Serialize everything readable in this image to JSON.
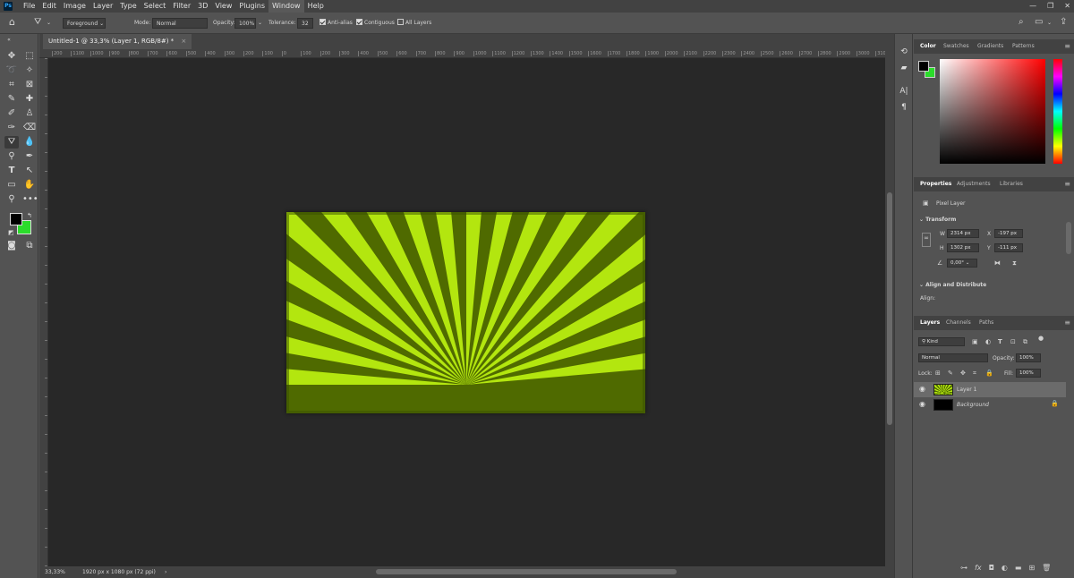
{
  "app": {
    "logo": "Ps"
  },
  "menu": [
    "File",
    "Edit",
    "Image",
    "Layer",
    "Type",
    "Select",
    "Filter",
    "3D",
    "View",
    "Plugins",
    "Window",
    "Help"
  ],
  "menu_active": "Window",
  "window_controls": [
    "—",
    "❐",
    "✕"
  ],
  "options": {
    "preset": "Foreground",
    "mode_label": "Mode:",
    "mode_value": "Normal",
    "opacity_label": "Opacity:",
    "opacity_value": "100%",
    "tolerance_label": "Tolerance:",
    "tolerance_value": "32",
    "anti_alias": "Anti-alias",
    "contiguous": "Contiguous",
    "all_layers": "All Layers",
    "anti_alias_checked": true,
    "contiguous_checked": true,
    "all_layers_checked": false
  },
  "document": {
    "tab_title": "Untitled-1 @ 33,3% (Layer 1, RGB/8#) *",
    "tab_close": "×"
  },
  "ruler_h": [
    "200",
    "1100",
    "1000",
    "900",
    "800",
    "700",
    "600",
    "500",
    "400",
    "300",
    "200",
    "100",
    "0",
    "100",
    "200",
    "300",
    "400",
    "500",
    "600",
    "700",
    "800",
    "900",
    "1000",
    "1100",
    "1200",
    "1300",
    "1400",
    "1500",
    "1600",
    "1700",
    "1800",
    "1900",
    "2000",
    "2100",
    "2200",
    "2300",
    "2400",
    "2500",
    "2600",
    "2700",
    "2800",
    "2900",
    "3000",
    "3100"
  ],
  "status": {
    "zoom": "33,33%",
    "doc_info": "1920 px x 1080 px (72 ppi)",
    "arrow": "›"
  },
  "color_panel": {
    "tabs": [
      "Color",
      "Swatches",
      "Gradients",
      "Patterns"
    ],
    "foreground": "#000000",
    "background": "#2bdc2b"
  },
  "properties_panel": {
    "tabs": [
      "Properties",
      "Adjustments",
      "Libraries"
    ],
    "kind": "Pixel Layer",
    "transform_title": "Transform",
    "w_label": "W",
    "w_value": "2314 px",
    "h_label": "H",
    "h_value": "1302 px",
    "x_label": "X",
    "x_value": "-197 px",
    "y_label": "Y",
    "y_value": "-111 px",
    "angle_value": "0,00°",
    "align_title": "Align and Distribute",
    "align_label": "Align:"
  },
  "layers_panel": {
    "tabs": [
      "Layers",
      "Channels",
      "Paths"
    ],
    "filter_kind": "Kind",
    "blend_mode": "Normal",
    "opacity_label": "Opacity:",
    "opacity_value": "100%",
    "lock_label": "Lock:",
    "fill_label": "Fill:",
    "fill_value": "100%",
    "layers": [
      {
        "name": "Layer 1",
        "selected": true,
        "locked": false
      },
      {
        "name": "Background",
        "selected": false,
        "locked": true
      }
    ],
    "footer_icons": [
      "link-icon",
      "fx-icon",
      "mask-icon",
      "adjustment-icon",
      "group-icon",
      "new-layer-icon",
      "trash-icon"
    ]
  },
  "colors": {
    "ray_light": "#b3e60f",
    "ray_dark": "#4f6a00"
  }
}
